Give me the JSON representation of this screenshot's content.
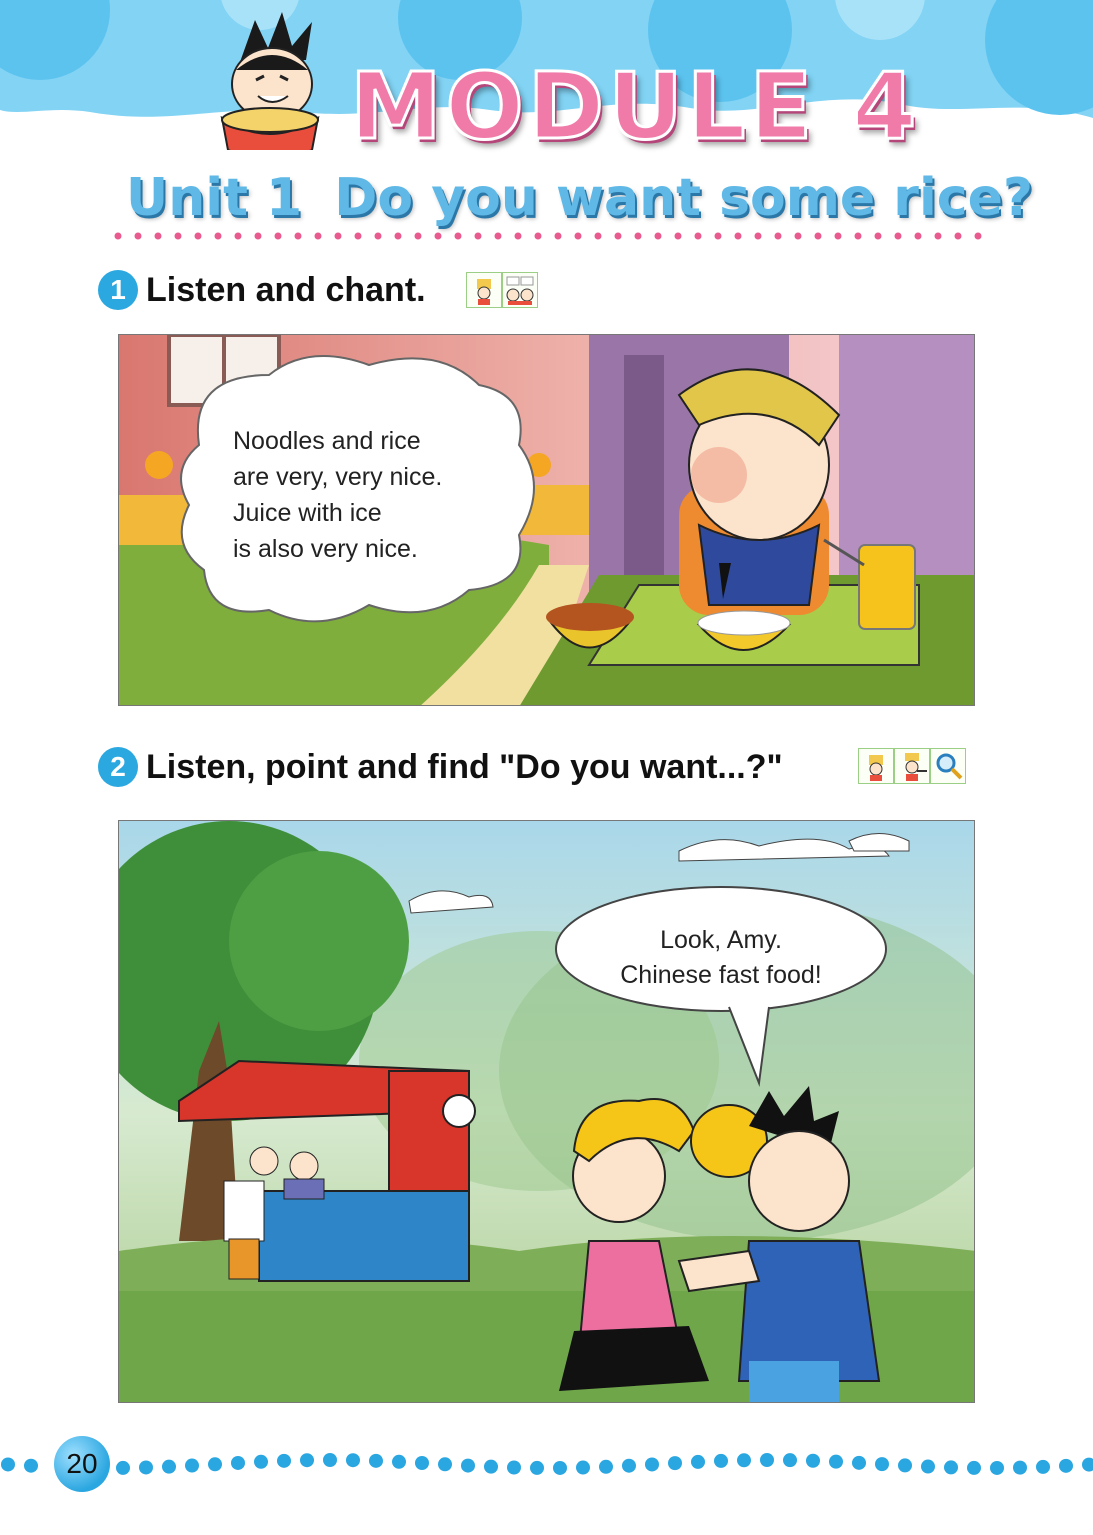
{
  "header": {
    "module_title": "MODULE 4",
    "unit_title_part1": "Unit 1",
    "unit_title_part2": "Do you want some rice?"
  },
  "section1": {
    "number": "1",
    "label": "Listen and chant.",
    "icons": [
      "listen-icon",
      "chant-icon"
    ],
    "chant_lines": [
      "Noodles and rice",
      "are very, very nice.",
      "Juice with ice",
      "is also very nice."
    ]
  },
  "section2": {
    "number": "2",
    "label": "Listen, point and find \"Do you want...?\"",
    "icons": [
      "listen-icon",
      "point-icon",
      "find-magnifier-icon"
    ],
    "speech_lines": [
      "Look, Amy.",
      "Chinese fast food!"
    ]
  },
  "footer": {
    "page_number": "20"
  },
  "colors": {
    "sky_blue": "#7fd0f3",
    "title_pink": "#f07aa8",
    "unit_blue": "#5fb8e6",
    "section_badge": "#2ba8e0",
    "dot_pink": "#e95a8f"
  }
}
